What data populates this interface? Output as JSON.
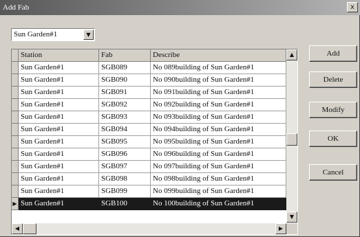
{
  "window": {
    "title": "Add Fab",
    "close_glyph": "x"
  },
  "combo": {
    "value": "Sun Garden#1",
    "arrow_icon": "chevron-down-icon"
  },
  "grid": {
    "columns": [
      "Station",
      "Fab",
      "Describe"
    ],
    "rows": [
      [
        "Sun Garden#1",
        "SGB089",
        "No 089building of Sun Garden#1"
      ],
      [
        "Sun Garden#1",
        "SGB090",
        "No 090building of Sun Garden#1"
      ],
      [
        "Sun Garden#1",
        "SGB091",
        "No 091building of Sun Garden#1"
      ],
      [
        "Sun Garden#1",
        "SGB092",
        "No 092building of Sun Garden#1"
      ],
      [
        "Sun Garden#1",
        "SGB093",
        "No 093building of Sun Garden#1"
      ],
      [
        "Sun Garden#1",
        "SGB094",
        "No 094building of Sun Garden#1"
      ],
      [
        "Sun Garden#1",
        "SGB095",
        "No 095building of Sun Garden#1"
      ],
      [
        "Sun Garden#1",
        "SGB096",
        "No 096building of Sun Garden#1"
      ],
      [
        "Sun Garden#1",
        "SGB097",
        "No 097building of Sun Garden#1"
      ],
      [
        "Sun Garden#1",
        "SGB098",
        "No 098building of Sun Garden#1"
      ],
      [
        "Sun Garden#1",
        "SGB099",
        "No 099building of Sun Garden#1"
      ],
      [
        "Sun Garden#1",
        "SGB100",
        "No 100building of Sun Garden#1"
      ]
    ],
    "selected_row": 11
  },
  "buttons": {
    "add": "Add",
    "delete": "Delete",
    "modify": "Modify",
    "ok": "OK",
    "cancel": "Cancel"
  },
  "colors": {
    "selection": "#1a1a1a",
    "face": "#d4d0c8"
  }
}
